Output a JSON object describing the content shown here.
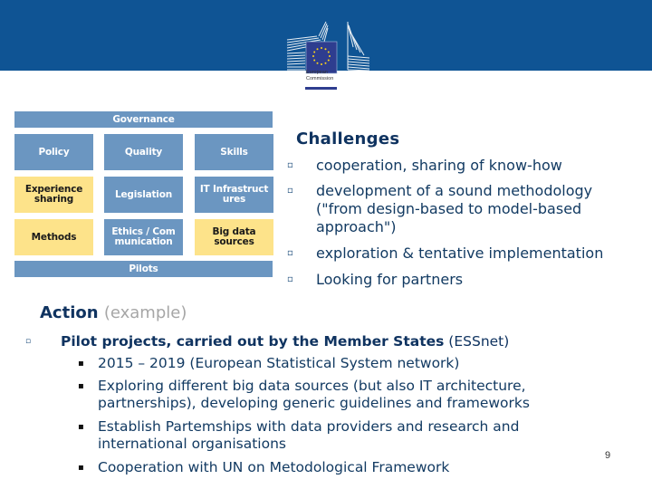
{
  "header": {
    "logo": {
      "name": "european-commission-logo",
      "line1": "European",
      "line2": "Commission"
    },
    "brand_color": "#0f5494"
  },
  "diagram": {
    "top_bar": "Governance",
    "bottom_bar": "Pilots",
    "rows": [
      [
        {
          "label": "Policy",
          "color": "blue"
        },
        {
          "label": "Quality",
          "color": "blue"
        },
        {
          "label": "Skills",
          "color": "blue"
        }
      ],
      [
        {
          "label": "Experience sharing",
          "color": "yellow"
        },
        {
          "label": "Legislation",
          "color": "blue"
        },
        {
          "label": "IT Infrastructures",
          "color": "blue"
        }
      ],
      [
        {
          "label": "Methods",
          "color": "yellow"
        },
        {
          "label": "Ethics / Communication",
          "color": "blue"
        },
        {
          "label": "Big data sources",
          "color": "yellow"
        }
      ]
    ],
    "colors": {
      "blue": "#6b96c1",
      "yellow": "#fde38a"
    }
  },
  "challenges": {
    "title": "Challenges",
    "bullet_glyph": "▫",
    "items": [
      {
        "lines": [
          "cooperation, sharing of know-how"
        ]
      },
      {
        "lines": [
          "development of a sound methodology",
          "(\"from design-based to model-based",
          "approach\")"
        ]
      },
      {
        "lines": [
          "exploration & tentative implementation"
        ]
      },
      {
        "lines": [
          "Looking for partners"
        ]
      }
    ]
  },
  "action": {
    "title": "Action",
    "title_note": "(example)",
    "main_item": {
      "bold_text": "Pilot projects, carried out by the Member States",
      "normal_text": " (ESSnet)"
    },
    "sub_bullet_glyph": "▪",
    "sub_items": [
      {
        "lines": [
          "2015 – 2019 (European Statistical System network)"
        ]
      },
      {
        "lines": [
          "Exploring different big data sources (but also IT architecture,",
          "partnerships), developing generic guidelines and frameworks"
        ]
      },
      {
        "lines": [
          "Establish Partemships with data providers and research and",
          "international organisations"
        ]
      },
      {
        "lines": [
          "Cooperation with UN on Metodological Framework"
        ]
      }
    ]
  },
  "page_number": "9"
}
